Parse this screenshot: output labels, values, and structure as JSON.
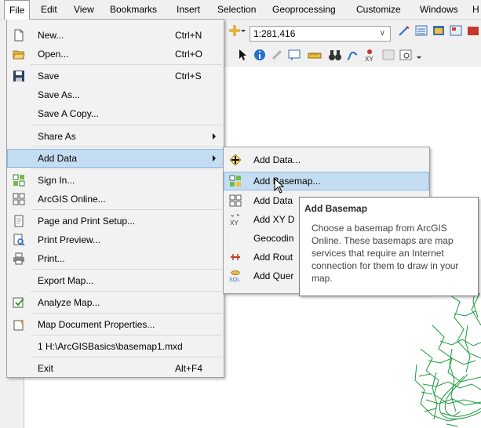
{
  "menubar": {
    "items": [
      "File",
      "Edit",
      "View",
      "Bookmarks",
      "Insert",
      "Selection",
      "Geoprocessing",
      "Customize",
      "Windows",
      "H"
    ]
  },
  "toolbar": {
    "scale_value": "1:281,416"
  },
  "file_menu": {
    "items": [
      {
        "label": "New...",
        "shortcut": "Ctrl+N",
        "icon": "new-document-icon"
      },
      {
        "label": "Open...",
        "shortcut": "Ctrl+O",
        "icon": "open-folder-icon"
      },
      {
        "label": "Save",
        "shortcut": "Ctrl+S",
        "icon": "save-disk-icon"
      },
      {
        "label": "Save As...",
        "shortcut": "",
        "icon": ""
      },
      {
        "label": "Save A Copy...",
        "shortcut": "",
        "icon": ""
      },
      {
        "label": "Share As",
        "shortcut": "",
        "icon": ""
      },
      {
        "label": "Add Data",
        "shortcut": "",
        "icon": ""
      },
      {
        "label": "Sign In...",
        "shortcut": "",
        "icon": "sign-in-grid-icon"
      },
      {
        "label": "ArcGIS Online...",
        "shortcut": "",
        "icon": "arcgis-online-grid-icon"
      },
      {
        "label": "Page and Print Setup...",
        "shortcut": "",
        "icon": "page-setup-icon"
      },
      {
        "label": "Print Preview...",
        "shortcut": "",
        "icon": "print-preview-icon"
      },
      {
        "label": "Print...",
        "shortcut": "",
        "icon": "printer-icon"
      },
      {
        "label": "Export Map...",
        "shortcut": "",
        "icon": ""
      },
      {
        "label": "Analyze Map...",
        "shortcut": "",
        "icon": "analyze-map-icon"
      },
      {
        "label": "Map Document Properties...",
        "shortcut": "",
        "icon": "document-properties-icon"
      },
      {
        "label": "1 H:\\ArcGISBasics\\basemap1.mxd",
        "shortcut": "",
        "icon": ""
      },
      {
        "label": "Exit",
        "shortcut": "Alt+F4",
        "icon": ""
      }
    ]
  },
  "add_data_submenu": {
    "items": [
      {
        "label": "Add Data...",
        "icon": "add-data-plus-icon"
      },
      {
        "label": "Add Basemap...",
        "icon": "basemap-grid-icon"
      },
      {
        "label": "Add Data",
        "icon": "add-data-grid-icon"
      },
      {
        "label": "Add XY D",
        "icon": "xy-data-icon"
      },
      {
        "label": "Geocodin",
        "icon": ""
      },
      {
        "label": "Add Rout",
        "icon": "route-icon"
      },
      {
        "label": "Add Quer",
        "icon": "sql-query-icon"
      }
    ]
  },
  "tooltip": {
    "title": "Add Basemap",
    "body": "Choose a basemap from ArcGIS Online. These basemaps are map services that require an Internet connection for them to draw in your map."
  },
  "colors": {
    "highlight": "#c5ddf2",
    "highlight_border": "#8ebbe6",
    "menu_bg": "#f2f2f2",
    "map_lines": "#1a9a3a"
  }
}
